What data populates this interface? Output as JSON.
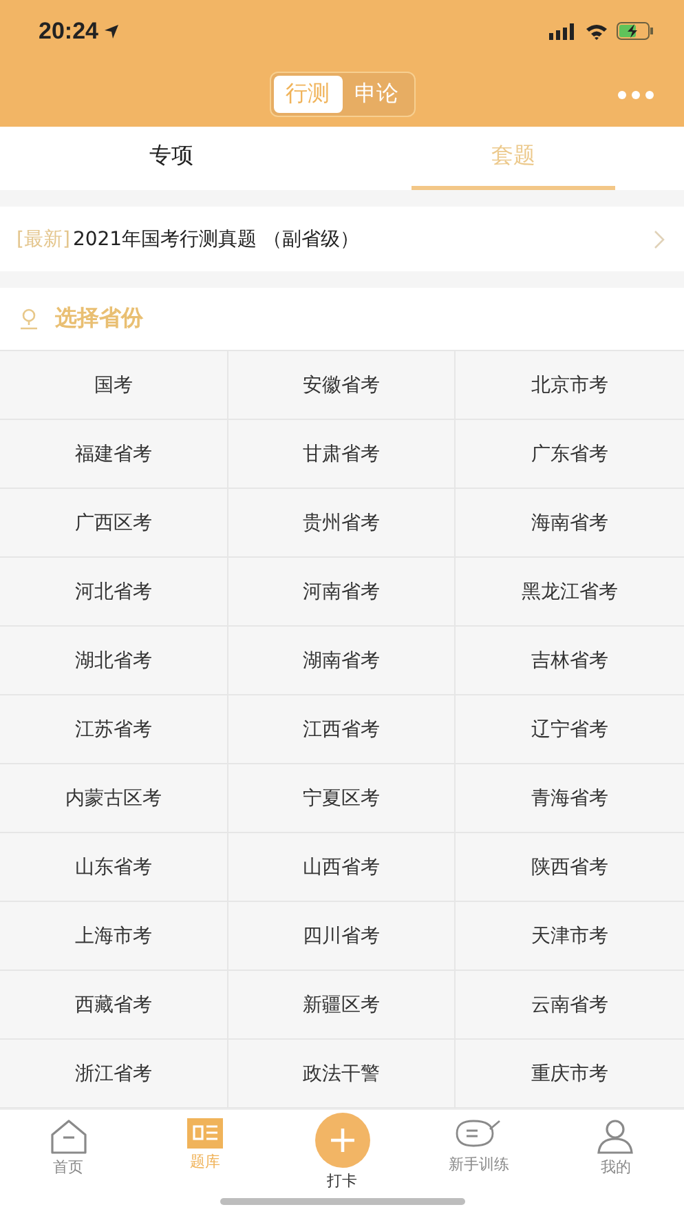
{
  "status_bar": {
    "time": "20:24"
  },
  "segments": [
    {
      "label": "行测",
      "selected": true
    },
    {
      "label": "申论",
      "selected": false
    }
  ],
  "tabs": [
    {
      "label": "专项",
      "selected": false
    },
    {
      "label": "套题",
      "selected": true
    }
  ],
  "banner": {
    "tag": "[最新]",
    "title": "2021年国考行测真题 （副省级）"
  },
  "section": {
    "title": "选择省份"
  },
  "provinces": [
    "国考",
    "安徽省考",
    "北京市考",
    "福建省考",
    "甘肃省考",
    "广东省考",
    "广西区考",
    "贵州省考",
    "海南省考",
    "河北省考",
    "河南省考",
    "黑龙江省考",
    "湖北省考",
    "湖南省考",
    "吉林省考",
    "江苏省考",
    "江西省考",
    "辽宁省考",
    "内蒙古区考",
    "宁夏区考",
    "青海省考",
    "山东省考",
    "山西省考",
    "陕西省考",
    "上海市考",
    "四川省考",
    "天津市考",
    "西藏省考",
    "新疆区考",
    "云南省考",
    "浙江省考",
    "政法干警",
    "重庆市考"
  ],
  "nav": [
    {
      "kind": "home",
      "label": "首页",
      "selected": false
    },
    {
      "kind": "bank",
      "label": "题库",
      "selected": true
    },
    {
      "kind": "add",
      "label": "打卡",
      "selected": false
    },
    {
      "kind": "train",
      "label": "新手训练",
      "selected": false
    },
    {
      "kind": "me",
      "label": "我的",
      "selected": false
    }
  ]
}
